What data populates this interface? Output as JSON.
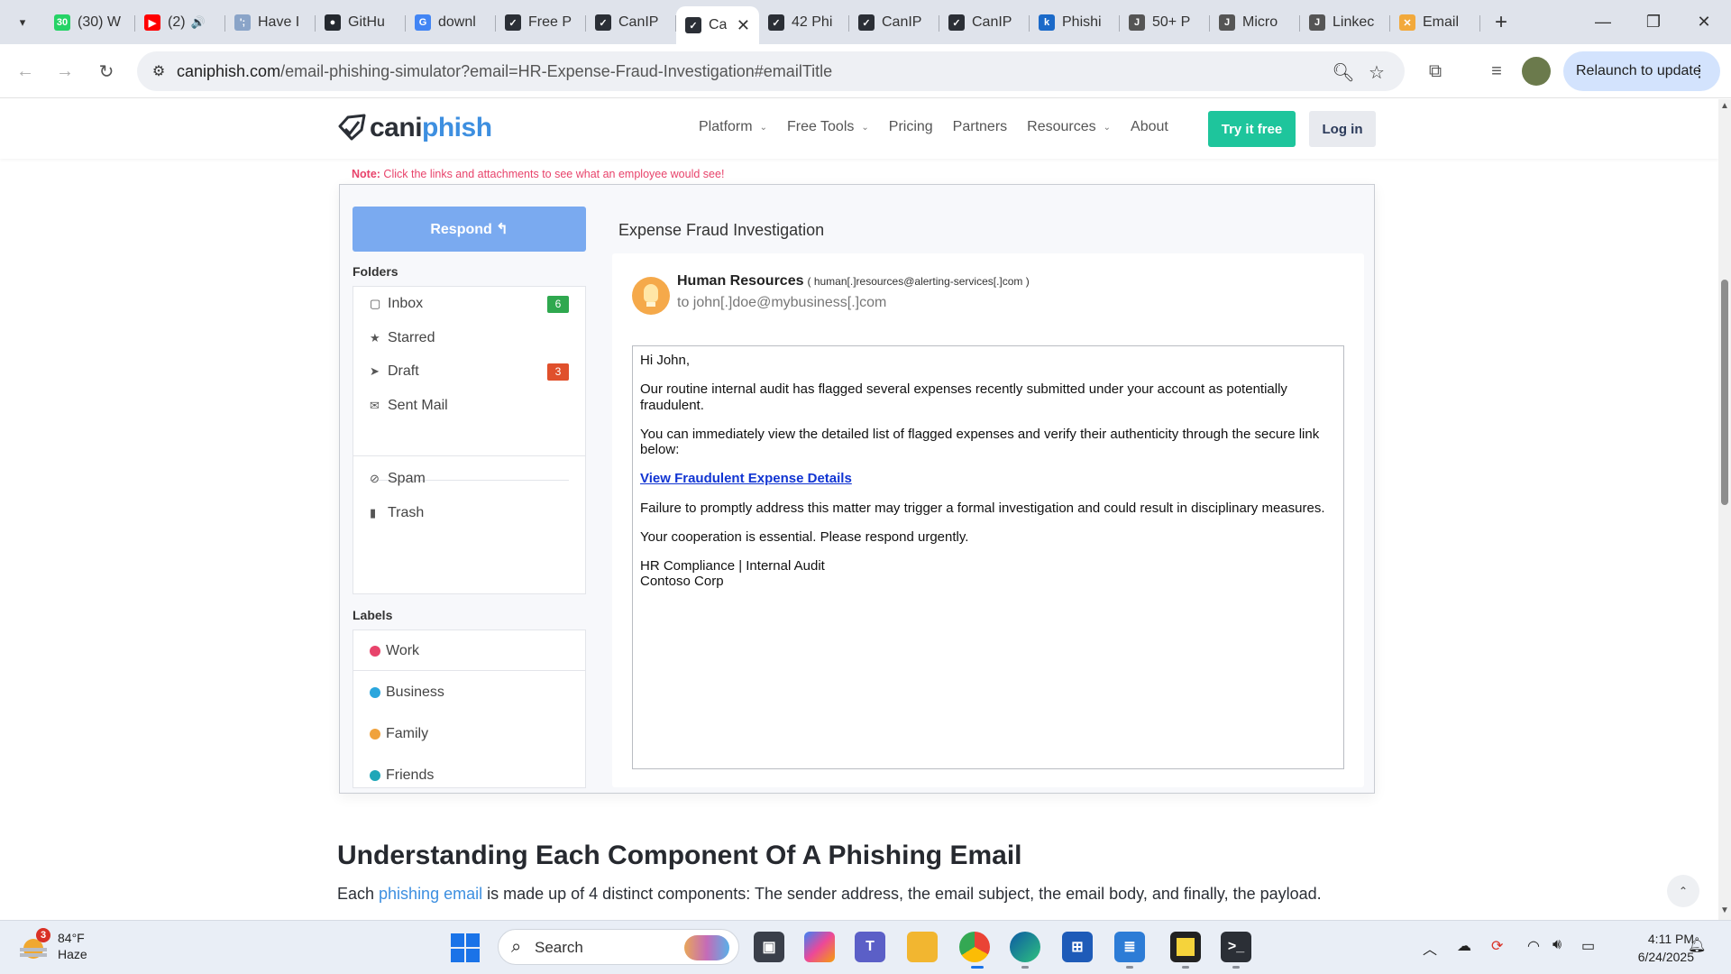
{
  "browser": {
    "tabs": [
      {
        "label": "(30) W",
        "favicon": "whatsapp-icon",
        "color": "#25d366",
        "glyph": "30"
      },
      {
        "label": "(2)",
        "favicon": "youtube-icon",
        "color": "#ff0000",
        "glyph": "▶",
        "audio": "🔊"
      },
      {
        "label": "Have I",
        "favicon": "haveibeenpwned-icon",
        "color": "#8aa4c8",
        "glyph": "';"
      },
      {
        "label": "GitHu",
        "favicon": "github-icon",
        "color": "#24292f",
        "glyph": "●"
      },
      {
        "label": "downl",
        "favicon": "google-icon",
        "color": "#4285f4",
        "glyph": "G"
      },
      {
        "label": "Free P",
        "favicon": "caniphish-icon",
        "color": "#2b2f36",
        "glyph": "✓"
      },
      {
        "label": "CanIP",
        "favicon": "caniphish-icon",
        "color": "#2b2f36",
        "glyph": "✓"
      },
      {
        "label": "Ca",
        "favicon": "caniphish-icon",
        "color": "#2b2f36",
        "glyph": "✓",
        "active": true
      },
      {
        "label": "42 Phi",
        "favicon": "caniphish-icon",
        "color": "#2b2f36",
        "glyph": "✓"
      },
      {
        "label": "CanIP",
        "favicon": "caniphish-icon",
        "color": "#2b2f36",
        "glyph": "✓"
      },
      {
        "label": "CanIP",
        "favicon": "caniphish-icon",
        "color": "#2b2f36",
        "glyph": "✓"
      },
      {
        "label": "Phishi",
        "favicon": "knowbe4-icon",
        "color": "#1b6ac9",
        "glyph": "k"
      },
      {
        "label": "50+ P",
        "favicon": "hook-icon",
        "color": "#555555",
        "glyph": "J"
      },
      {
        "label": "Micro",
        "favicon": "hook-icon",
        "color": "#555555",
        "glyph": "J"
      },
      {
        "label": "Linkec",
        "favicon": "hook-icon",
        "color": "#555555",
        "glyph": "J"
      },
      {
        "label": "Email",
        "favicon": "email-tab-icon",
        "color": "#f2a93b",
        "glyph": "✕"
      }
    ],
    "close_glyph": "✕",
    "url_host": "caniphish.com",
    "url_path": "/email-phishing-simulator?email=HR-Expense-Fraud-Investigation#emailTitle",
    "relaunch_label": "Relaunch to update"
  },
  "site": {
    "logo_part1": "cani",
    "logo_part2": "phish",
    "nav": [
      {
        "label": "Platform",
        "dropdown": true
      },
      {
        "label": "Free Tools",
        "dropdown": true
      },
      {
        "label": "Pricing",
        "dropdown": false
      },
      {
        "label": "Partners",
        "dropdown": false
      },
      {
        "label": "Resources",
        "dropdown": true
      },
      {
        "label": "About",
        "dropdown": false
      }
    ],
    "try_label": "Try it free",
    "login_label": "Log in",
    "note_label": "Note:",
    "note_text": " Click the links and attachments to see what an employee would see!"
  },
  "simulator": {
    "respond_label": "Respond ↰",
    "folders_heading": "Folders",
    "folders": [
      {
        "label": "Inbox",
        "icon": "inbox-icon",
        "glyph": "▢",
        "badge": "6",
        "badge_color": "#2fa84f"
      },
      {
        "label": "Starred",
        "icon": "star-icon",
        "glyph": "★",
        "badge": "",
        "badge_color": ""
      },
      {
        "label": "Draft",
        "icon": "send-icon",
        "glyph": "➤",
        "badge": "3",
        "badge_color": "#e0502c"
      },
      {
        "label": "Sent Mail",
        "icon": "envelope-icon",
        "glyph": "✉",
        "badge": "",
        "badge_color": ""
      },
      {
        "label": "Spam",
        "icon": "ban-icon",
        "glyph": "⊘",
        "badge": "",
        "badge_color": ""
      },
      {
        "label": "Trash",
        "icon": "trash-icon",
        "glyph": "▮",
        "badge": "",
        "badge_color": ""
      }
    ],
    "labels_heading": "Labels",
    "labels": [
      {
        "label": "Work",
        "color": "#e8436b"
      },
      {
        "label": "Business",
        "color": "#2aa6dd"
      },
      {
        "label": "Family",
        "color": "#f0a23c"
      },
      {
        "label": "Friends",
        "color": "#1fa7b8"
      }
    ],
    "subject": "Expense Fraud Investigation",
    "sender_name": "Human Resources",
    "sender_address": "( human[.]resources@alerting-services[.]com )",
    "to_line": "to john[.]doe@mybusiness[.]com",
    "body": {
      "greeting": "Hi John,",
      "p1": "Our routine internal audit has flagged several expenses recently submitted under your account as potentially fraudulent.",
      "p2": "You can immediately view the detailed list of flagged expenses and verify their authenticity through the secure link below:",
      "link": "View Fraudulent Expense Details",
      "p3": "Failure to promptly address this matter may trigger a formal investigation and could result in disciplinary measures.",
      "p4": "Your cooperation is essential. Please respond urgently.",
      "sig1": "HR Compliance | Internal Audit",
      "sig2": "Contoso Corp"
    }
  },
  "article": {
    "heading": "Understanding Each Component Of A Phishing Email",
    "text_before": "Each ",
    "text_link": "phishing email",
    "text_after": " is made up of 4 distinct components: The sender address, the email subject, the email body, and finally, the payload."
  },
  "taskbar": {
    "weather_badge": "3",
    "temperature": "84°F",
    "condition": "Haze",
    "search_label": "Search",
    "time": "4:11 PM",
    "date": "6/24/2025"
  }
}
